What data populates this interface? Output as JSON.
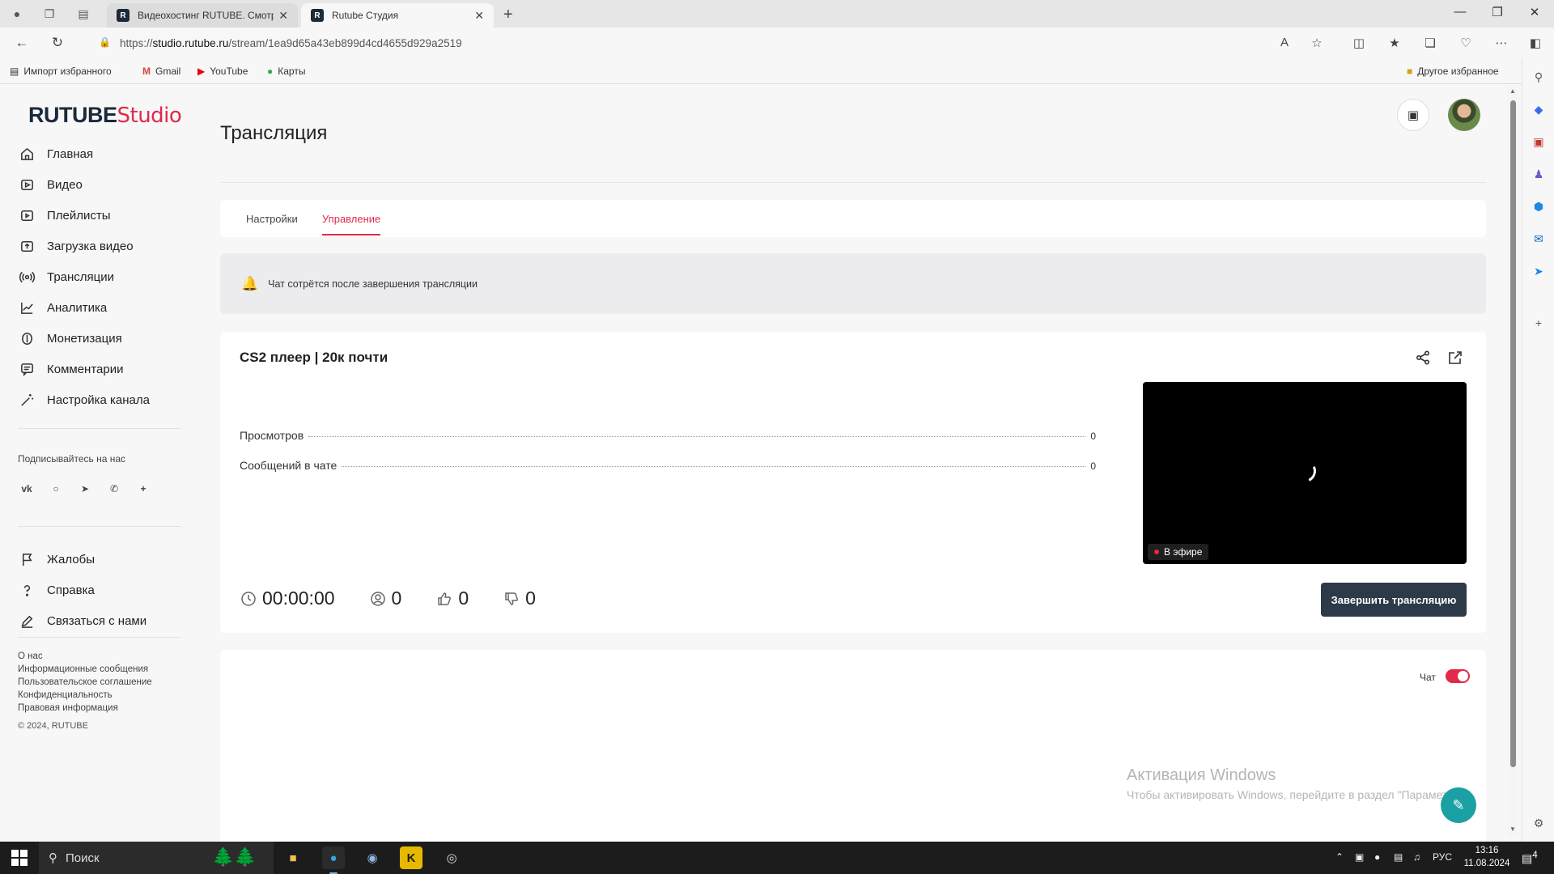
{
  "browser": {
    "tabs": [
      {
        "title": "Видеохостинг RUTUBE. Смотрите",
        "favicon": "R",
        "active": false
      },
      {
        "title": "Rutube Студия",
        "favicon": "R",
        "active": true
      }
    ],
    "url_prefix": "https://",
    "url_host": "studio.rutube.ru",
    "url_path": "/stream/1ea9d65a43eb899d4cd4655d929a2519",
    "bookmarks": [
      {
        "label": "Импорт избранного",
        "icon": "import-icon"
      },
      {
        "label": "Gmail",
        "icon": "gmail-icon"
      },
      {
        "label": "YouTube",
        "icon": "youtube-icon"
      },
      {
        "label": "Карты",
        "icon": "maps-pin-icon"
      }
    ],
    "other_bookmarks": "Другое избранное"
  },
  "logo": {
    "part1": "RUTUBE",
    "part2": "Studio"
  },
  "sidebar": {
    "items": [
      {
        "label": "Главная",
        "icon": "home-icon"
      },
      {
        "label": "Видео",
        "icon": "video-icon"
      },
      {
        "label": "Плейлисты",
        "icon": "playlist-icon"
      },
      {
        "label": "Загрузка видео",
        "icon": "upload-icon"
      },
      {
        "label": "Трансляции",
        "icon": "broadcast-icon"
      },
      {
        "label": "Аналитика",
        "icon": "analytics-icon"
      },
      {
        "label": "Монетизация",
        "icon": "monetization-icon"
      },
      {
        "label": "Комментарии",
        "icon": "comments-icon"
      },
      {
        "label": "Настройка канала",
        "icon": "wand-icon"
      }
    ],
    "follow_title": "Подписывайтесь на нас",
    "socials": [
      "vk-icon",
      "ok-icon",
      "telegram-icon",
      "viber-icon",
      "plus-icon"
    ],
    "items2": [
      {
        "label": "Жалобы",
        "icon": "flag-icon"
      },
      {
        "label": "Справка",
        "icon": "help-icon"
      },
      {
        "label": "Связаться с нами",
        "icon": "pen-icon"
      }
    ],
    "footer_links": [
      "О нас",
      "Информационные сообщения",
      "Пользовательское соглашение",
      "Конфиденциальность",
      "Правовая информация"
    ],
    "copyright": "© 2024, RUTUBE"
  },
  "main": {
    "title": "Трансляция",
    "tabs": [
      {
        "label": "Настройки",
        "active": false
      },
      {
        "label": "Управление",
        "active": true
      }
    ],
    "notice": "Чат сотрётся после завершения трансляции",
    "stream": {
      "title": "CS2 плеер | 20к почти",
      "stats": [
        {
          "label": "Просмотров",
          "value": "0"
        },
        {
          "label": "Сообщений в чате",
          "value": "0"
        }
      ],
      "live_label": "В эфире",
      "duration": "00:00:00",
      "viewers": "0",
      "likes": "0",
      "dislikes": "0",
      "end_button": "Завершить трансляцию"
    },
    "chat": {
      "label": "Чат",
      "enabled": true
    }
  },
  "windows": {
    "activate_title": "Активация Windows",
    "activate_text": "Чтобы активировать Windows, перейдите в раздел \"Параметры\"."
  },
  "taskbar": {
    "search_placeholder": "Поиск",
    "lang": "РУС",
    "time": "13:16",
    "date": "11.08.2024",
    "notifications": "4"
  },
  "colors": {
    "accent": "#e1294a",
    "dark_button": "#2d3a48",
    "help_fab": "#1ba0a4"
  }
}
